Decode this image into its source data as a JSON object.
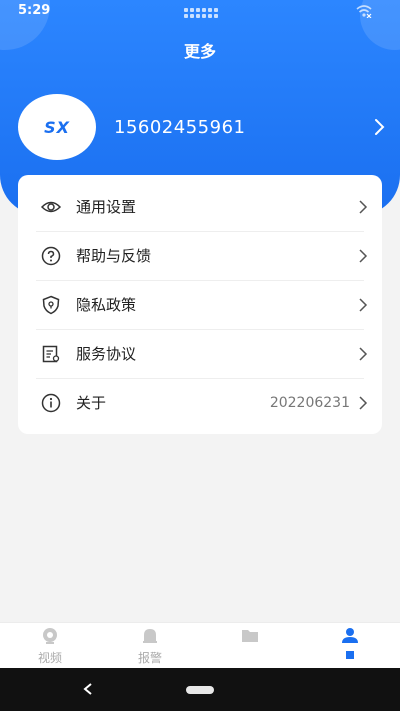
{
  "status": {
    "time": "5:29"
  },
  "header": {
    "title": "更多"
  },
  "profile": {
    "logo_text": "SX",
    "phone": "15602455961"
  },
  "menu": [
    {
      "label": "通用设置",
      "icon": "settings-eye-icon",
      "value": ""
    },
    {
      "label": "帮助与反馈",
      "icon": "help-icon",
      "value": ""
    },
    {
      "label": "隐私政策",
      "icon": "shield-icon",
      "value": ""
    },
    {
      "label": "服务协议",
      "icon": "document-icon",
      "value": ""
    },
    {
      "label": "关于",
      "icon": "info-icon",
      "value": "202206231"
    }
  ],
  "tabs": [
    {
      "label": "视频",
      "icon": "camera-icon"
    },
    {
      "label": "报警",
      "icon": "bell-icon"
    },
    {
      "label": "",
      "icon": "folder-icon"
    },
    {
      "label": "",
      "icon": "user-icon",
      "active": true
    }
  ],
  "colors": {
    "primary": "#1a6ff0",
    "header_top": "#2c86ff",
    "background": "#f3f3f3"
  }
}
